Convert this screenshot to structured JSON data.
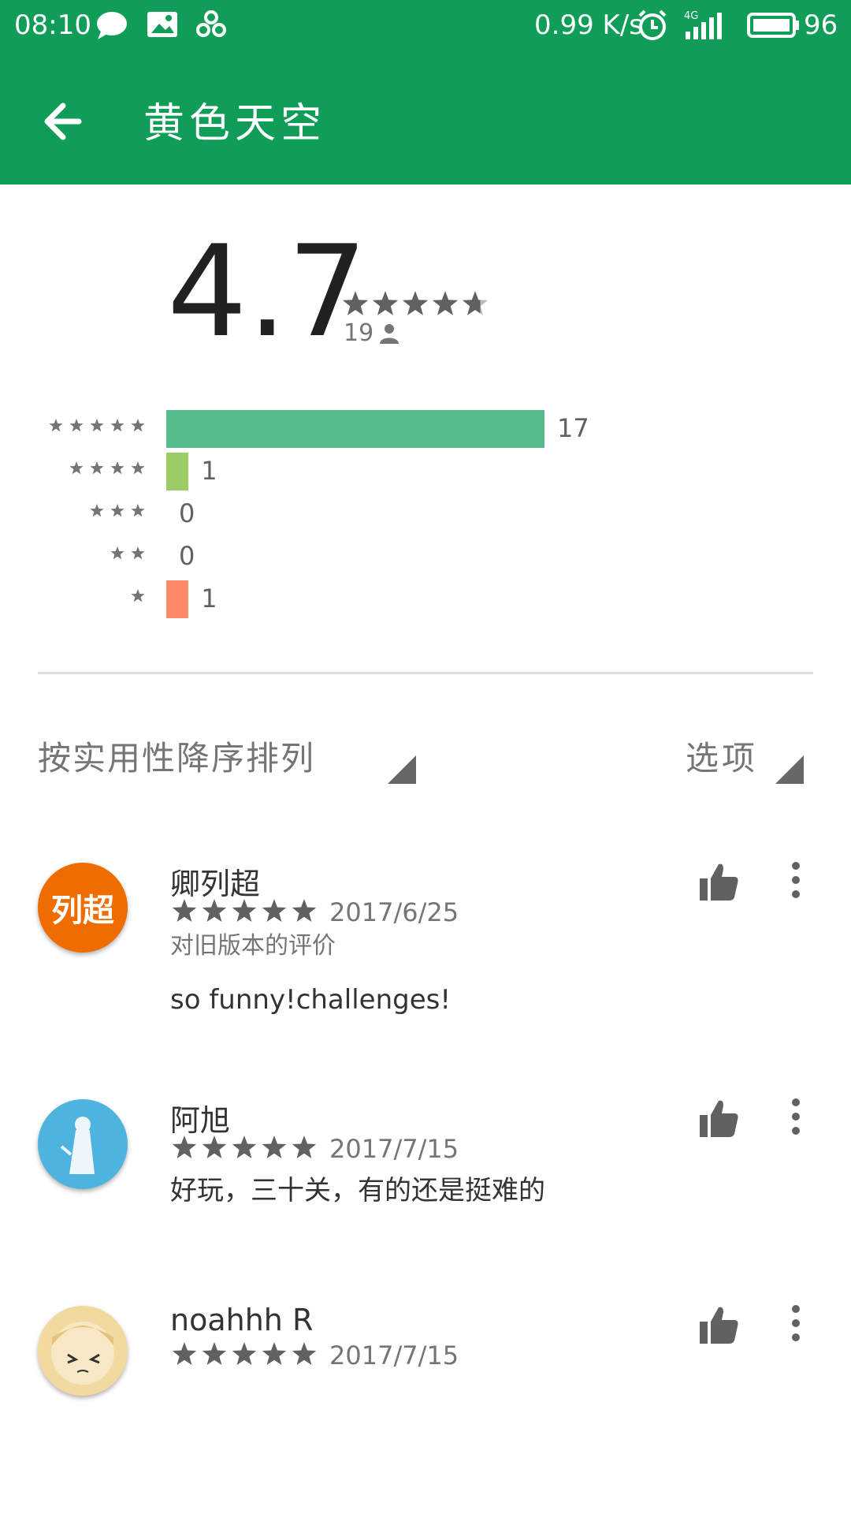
{
  "status_bar": {
    "time": "08:10",
    "network_speed": "0.99 K/s",
    "network_type": "4G",
    "battery": "96",
    "icons": [
      "message-icon",
      "image-icon",
      "clover-icon",
      "alarm-icon",
      "signal-icon",
      "battery-icon"
    ]
  },
  "app_bar": {
    "title": "黄色天空",
    "back_icon": "back-arrow-icon",
    "background": "#0f9d58"
  },
  "rating_summary": {
    "average": "4.7",
    "average_value": 4.7,
    "rating_count": "19",
    "histogram": [
      {
        "stars": 5,
        "count": "17",
        "value": 17,
        "color": "#57bb8a"
      },
      {
        "stars": 4,
        "count": "1",
        "value": 1,
        "color": "#9ccc65"
      },
      {
        "stars": 3,
        "count": "0",
        "value": 0,
        "color": "#ffd54f"
      },
      {
        "stars": 2,
        "count": "0",
        "value": 0,
        "color": "#ffb74d"
      },
      {
        "stars": 1,
        "count": "1",
        "value": 1,
        "color": "#ff8a65"
      }
    ]
  },
  "sort": {
    "label": "按实用性降序排列",
    "options_label": "选项"
  },
  "reviews": [
    {
      "name": "卿列超",
      "avatar_text": "列超",
      "avatar_color": "#ef6c00",
      "stars": 5,
      "date": "2017/6/25",
      "note": "对旧版本的评价",
      "text": "so funny!challenges!"
    },
    {
      "name": "阿旭",
      "avatar_text": "",
      "avatar_color": "#4fb3e0",
      "stars": 5,
      "date": "2017/7/15",
      "note": "",
      "text": "好玩，三十关，有的还是挺难的"
    },
    {
      "name": "noahhh R",
      "avatar_text": "",
      "avatar_color": "#f2d9a0",
      "stars": 5,
      "date": "2017/7/15",
      "note": "",
      "text": ""
    }
  ]
}
